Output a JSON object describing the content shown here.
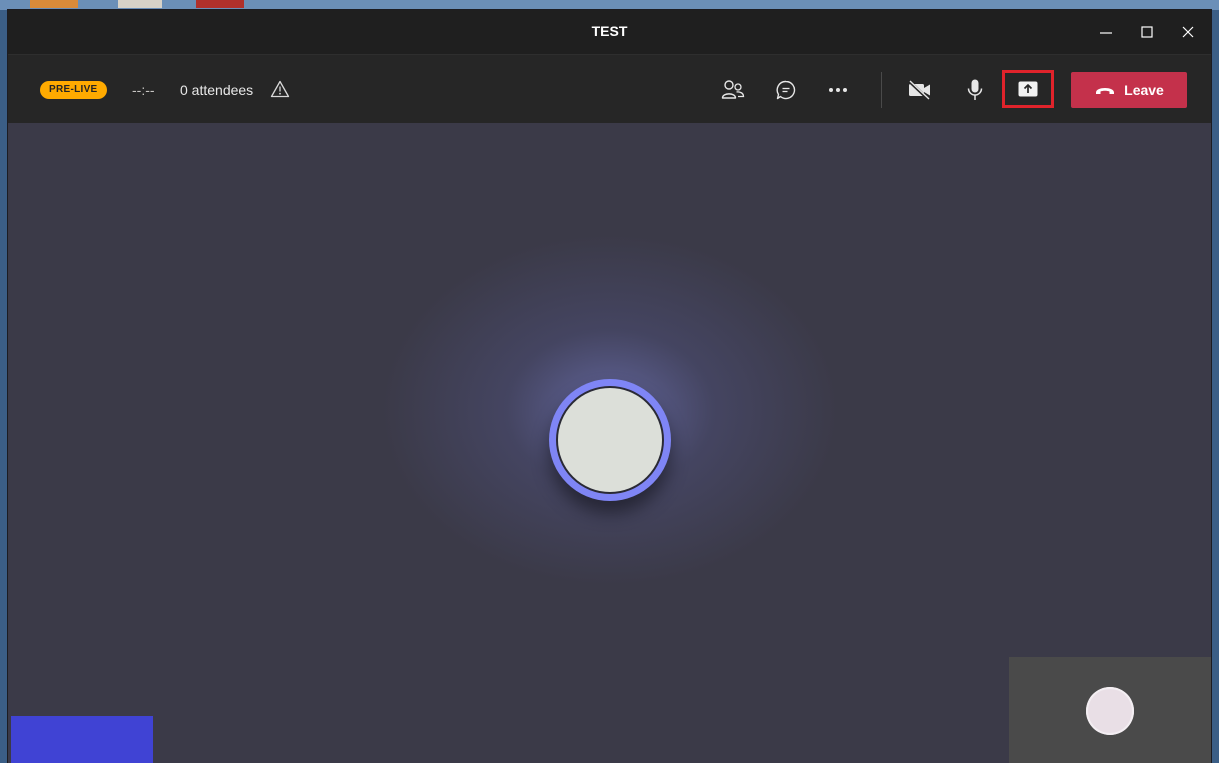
{
  "window": {
    "title": "TEST",
    "controls": [
      "minimize-icon",
      "maximize-icon",
      "close-icon"
    ]
  },
  "toolbar": {
    "status_badge": "PRE-LIVE",
    "timer": "--:--",
    "attendees": "0 attendees",
    "icons": [
      "participants-icon",
      "chat-icon",
      "more-options-icon",
      "camera-off-icon",
      "microphone-icon",
      "share-screen-icon",
      "hang-up-icon"
    ],
    "leave_label": "Leave"
  },
  "colors": {
    "titlebar": "#1f1f1f",
    "toolbar": "#262626",
    "stage": "#3b3a48",
    "badge": "#ffaa00",
    "leave": "#c4314b",
    "highlight": "#e0232b",
    "avatar_ring": "#7f85f5"
  }
}
